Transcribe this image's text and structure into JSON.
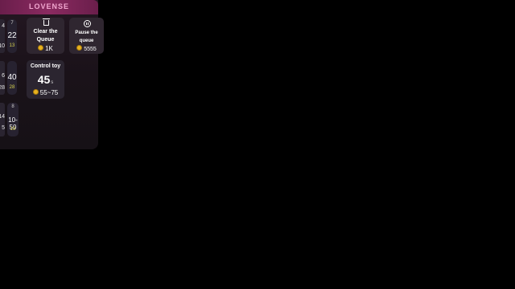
{
  "panel": {
    "brand": "LOVENSE",
    "edge_tiles": [
      {
        "top": "4",
        "bottom": "10"
      },
      {
        "top": "6",
        "bottom": "28"
      },
      {
        "top": "14",
        "bottom": "5"
      }
    ],
    "small_tiles": [
      {
        "top": "7",
        "value": "22",
        "bottom": "13"
      },
      {
        "top": "",
        "value": "40",
        "bottom": "28"
      },
      {
        "top": "8",
        "value": "10-50",
        "bottom": "18"
      }
    ],
    "clear_queue": {
      "label_line1": "Clear the",
      "label_line2": "Queue",
      "price": "1K",
      "icon": "trash-icon"
    },
    "pause_queue": {
      "label_line1": "Pause the",
      "label_line2": "queue",
      "price": "5555",
      "icon": "pause-icon"
    },
    "control_toy": {
      "label": "Control toy",
      "seconds": "45",
      "unit": "s",
      "price": "55~75"
    }
  },
  "colors": {
    "brand": "#f1a7cf",
    "coin": "#e8b21f",
    "header": "#8a2a60"
  }
}
